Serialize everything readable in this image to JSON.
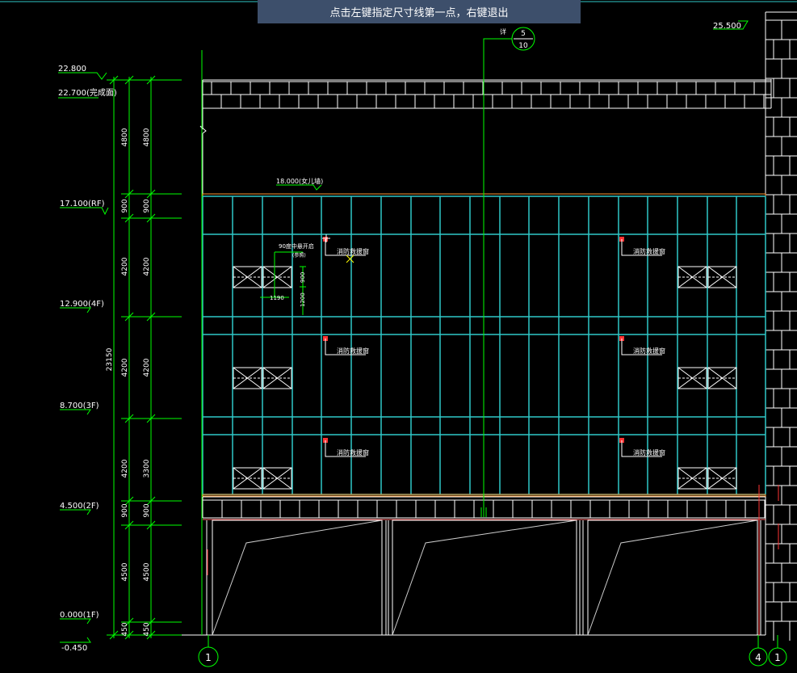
{
  "prompt": "点击左键指定尺寸线第一点，右键退出",
  "elevation_marks": {
    "top_right": "25.500",
    "roof_top": "22.800",
    "parapet": "22.700(完成面)",
    "rf": "17.100(RF)",
    "f4": "12.900(4F)",
    "f3": "8.700(3F)",
    "f2": "4.500(2F)",
    "f1": "0.000(1F)",
    "ground": "-0.450",
    "curtain_wall_top": "18.000(女儿墙)"
  },
  "dims_outer": [
    "4800",
    "900",
    "4200",
    "4200",
    "4200",
    "900",
    "4500",
    "450"
  ],
  "dims_inner": [
    "4800",
    "900",
    "4200",
    "4200",
    "3300",
    "900",
    "4500",
    "450"
  ],
  "dim_total": "23150",
  "window_label": "消防救援窗",
  "window_note": {
    "title": "90度中悬开启",
    "sub": "(参照)",
    "width": "1190",
    "h1": "900",
    "h2": "1200"
  },
  "detail_callout": {
    "top": "5",
    "bottom": "10",
    "prefix": "详"
  },
  "axes": {
    "left": "1",
    "right_a": "4",
    "right_b": "1"
  },
  "colors": {
    "background": "#000000",
    "wall": "#ffffff",
    "grid": "#2fc7c7",
    "dimension": "#00ff00",
    "text": "#ffffff",
    "accent": "#ff3333",
    "prompt_bg": "#3d4f6b"
  }
}
